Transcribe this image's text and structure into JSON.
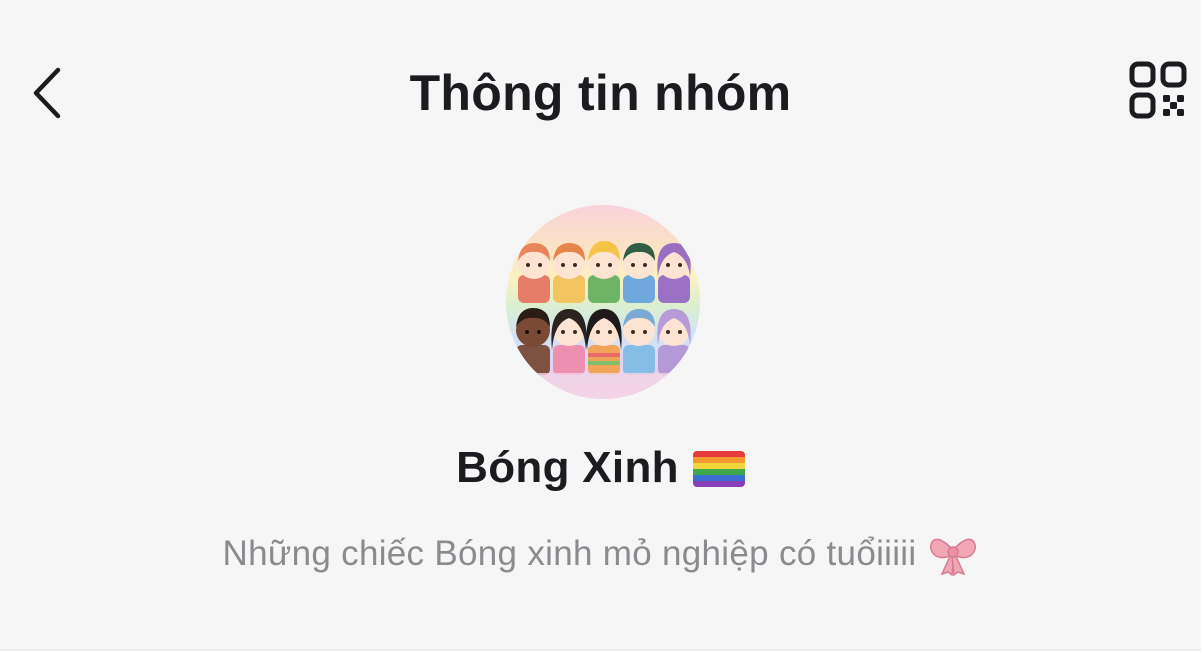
{
  "header": {
    "title": "Thông tin nhóm",
    "back_icon": "chevron-left-icon",
    "qr_icon": "qr-code-icon"
  },
  "group": {
    "name": "Bóng Xinh",
    "name_emoji": "rainbow-flag-icon",
    "description": "Những chiếc Bóng xinh mỏ nghiệp có tuổiiiii",
    "description_emoji": "ribbon-bow-icon"
  },
  "colors": {
    "background": "#f6f6f6",
    "title": "#1b1b20",
    "description": "#8b8b8f",
    "bow": "#f2a7b6"
  }
}
